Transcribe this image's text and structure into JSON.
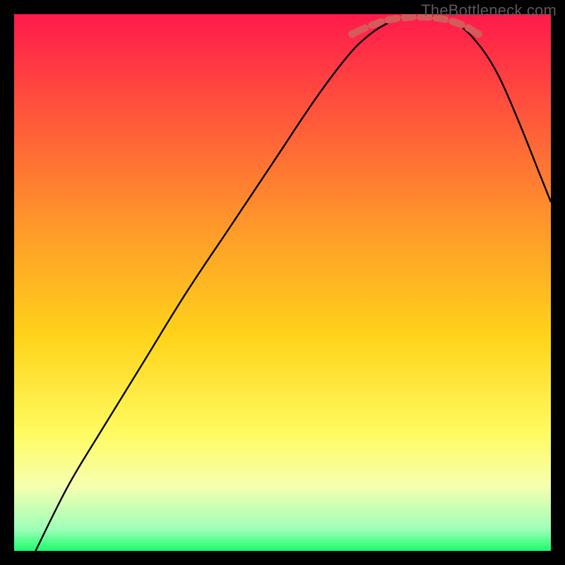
{
  "watermark": "TheBottleneck.com",
  "chart_data": {
    "type": "line",
    "title": "",
    "xlabel": "",
    "ylabel": "",
    "xlim": [
      0,
      100
    ],
    "ylim": [
      0,
      100
    ],
    "gradient_bands": [
      {
        "y": 0,
        "color": "#ff1a4b"
      },
      {
        "y": 20,
        "color": "#ff5a3a"
      },
      {
        "y": 40,
        "color": "#ff9a2a"
      },
      {
        "y": 60,
        "color": "#ffd31a"
      },
      {
        "y": 78,
        "color": "#fffb60"
      },
      {
        "y": 88,
        "color": "#f6ffb0"
      },
      {
        "y": 96,
        "color": "#9dffb8"
      },
      {
        "y": 100,
        "color": "#1bff6a"
      }
    ],
    "series": [
      {
        "name": "bottleneck-curve",
        "x": [
          4,
          10,
          16,
          24,
          32,
          40,
          48,
          56,
          62,
          66,
          70,
          74,
          78,
          82,
          86,
          90,
          94,
          98,
          100
        ],
        "y": [
          0,
          12,
          22,
          35,
          48,
          60,
          72,
          84,
          92,
          96,
          98.5,
          99.5,
          99.5,
          98.5,
          95,
          89,
          80,
          70,
          65
        ]
      }
    ],
    "markers": {
      "name": "optimal-zone",
      "style": "dashed-segments",
      "color": "#d65a5a",
      "points": [
        {
          "x": 63,
          "y": 96.3
        },
        {
          "x": 66,
          "y": 97.7
        },
        {
          "x": 69,
          "y": 98.8
        },
        {
          "x": 72,
          "y": 99.3
        },
        {
          "x": 75,
          "y": 99.5
        },
        {
          "x": 78,
          "y": 99.4
        },
        {
          "x": 81,
          "y": 98.9
        },
        {
          "x": 84,
          "y": 97.8
        },
        {
          "x": 86.5,
          "y": 96.3
        }
      ]
    }
  }
}
